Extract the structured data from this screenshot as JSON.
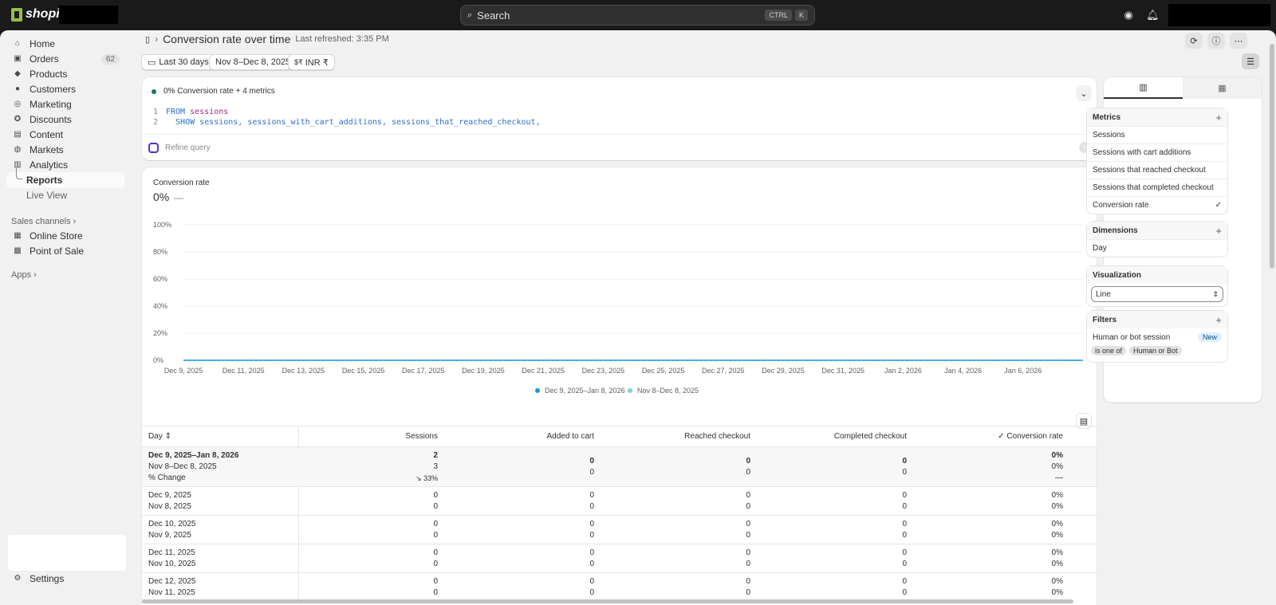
{
  "topbar": {
    "brand": "shopify",
    "search_placeholder": "Search",
    "kbd_ctrl": "CTRL",
    "kbd_k": "K"
  },
  "sidebar": {
    "items": [
      {
        "label": "Home",
        "icon": "home-icon"
      },
      {
        "label": "Orders",
        "icon": "orders-icon",
        "badge": "62"
      },
      {
        "label": "Products",
        "icon": "tag-icon"
      },
      {
        "label": "Customers",
        "icon": "person-icon"
      },
      {
        "label": "Marketing",
        "icon": "target-icon"
      },
      {
        "label": "Discounts",
        "icon": "discount-icon"
      },
      {
        "label": "Content",
        "icon": "content-icon"
      },
      {
        "label": "Markets",
        "icon": "globe-icon"
      },
      {
        "label": "Analytics",
        "icon": "bar-chart-icon"
      },
      {
        "label": "Reports"
      },
      {
        "label": "Live View"
      }
    ],
    "sales_channels_label": "Sales channels",
    "channels": [
      {
        "label": "Online Store"
      },
      {
        "label": "Point of Sale"
      }
    ],
    "apps_label": "Apps",
    "settings_label": "Settings"
  },
  "header": {
    "title": "Conversion rate over time",
    "refreshed": "Last refreshed: 3:35 PM"
  },
  "filters": {
    "range": "Last 30 days",
    "compare": "Nov 8–Dec 8, 2025",
    "currency": "INR ₹"
  },
  "query": {
    "summary": "0% Conversion rate + 4 metrics",
    "line1_num": "1",
    "line1_kw": "FROM",
    "line1_id": "sessions",
    "line2_num": "2",
    "line2_text": "  SHOW sessions, sessions_with_cart_additions, sessions_that_reached_checkout,",
    "refine": "Refine query"
  },
  "chart_data": {
    "type": "line",
    "title": "Conversion rate",
    "value": "0%",
    "value_change": "—",
    "ylabel": "",
    "xlabel": "",
    "ylim": [
      0,
      100
    ],
    "y_ticks": [
      "100%",
      "80%",
      "60%",
      "40%",
      "20%",
      "0%"
    ],
    "x_ticks": [
      "Dec 9, 2025",
      "Dec 11, 2025",
      "Dec 13, 2025",
      "Dec 15, 2025",
      "Dec 17, 2025",
      "Dec 19, 2025",
      "Dec 21, 2025",
      "Dec 23, 2025",
      "Dec 25, 2025",
      "Dec 27, 2025",
      "Dec 29, 2025",
      "Dec 31, 2025",
      "Jan 2, 2026",
      "Jan 4, 2026",
      "Jan 6, 2026"
    ],
    "series": [
      {
        "name": "Dec 9, 2025–Jan 8, 2026",
        "color": "#1f96e0",
        "values": [
          0,
          0,
          0,
          0,
          0,
          0,
          0,
          0,
          0,
          0,
          0,
          0,
          0,
          0,
          0,
          0,
          0,
          0,
          0,
          0,
          0,
          0,
          0,
          0,
          0,
          0,
          0,
          0,
          0,
          0,
          0
        ]
      },
      {
        "name": "Nov 8–Dec 8, 2025",
        "color": "#7dd3e0",
        "values": [
          0,
          0,
          0,
          0,
          0,
          0,
          0,
          0,
          0,
          0,
          0,
          0,
          0,
          0,
          0,
          0,
          0,
          0,
          0,
          0,
          0,
          0,
          0,
          0,
          0,
          0,
          0,
          0,
          0,
          0,
          0
        ]
      }
    ],
    "grid": true,
    "legend": "bottom"
  },
  "table": {
    "headers": [
      "Day",
      "Sessions",
      "Added to cart",
      "Reached checkout",
      "Completed checkout",
      "Conversion rate"
    ],
    "summary": {
      "labels": [
        "Dec 9, 2025–Jan 8, 2026",
        "Nov 8–Dec 8, 2025",
        "% Change"
      ],
      "sessions": [
        "2",
        "3",
        "↘ 33%"
      ],
      "added": [
        "0",
        "0"
      ],
      "reached": [
        "0",
        "0"
      ],
      "completed": [
        "0",
        "0"
      ],
      "conv": [
        "0%",
        "0%",
        "—"
      ]
    },
    "rows": [
      {
        "d1": "Dec 9, 2025",
        "d2": "Nov 8, 2025",
        "v": [
          "0",
          "0",
          "0",
          "0",
          "0",
          "0",
          "0",
          "0"
        ],
        "c1": "0%",
        "c2": "0%"
      },
      {
        "d1": "Dec 10, 2025",
        "d2": "Nov 9, 2025",
        "v": [
          "0",
          "0",
          "0",
          "0",
          "0",
          "0",
          "0",
          "0"
        ],
        "c1": "0%",
        "c2": "0%"
      },
      {
        "d1": "Dec 11, 2025",
        "d2": "Nov 10, 2025",
        "v": [
          "0",
          "0",
          "0",
          "0",
          "0",
          "0",
          "0",
          "0"
        ],
        "c1": "0%",
        "c2": "0%"
      },
      {
        "d1": "Dec 12, 2025",
        "d2": "Nov 11, 2025",
        "v": [
          "0",
          "0",
          "0",
          "0",
          "0",
          "0",
          "0",
          "0"
        ],
        "c1": "0%",
        "c2": "0%"
      }
    ]
  },
  "right_panel": {
    "metrics_label": "Metrics",
    "metrics": [
      "Sessions",
      "Sessions with cart additions",
      "Sessions that reached checkout",
      "Sessions that completed checkout",
      "Conversion rate"
    ],
    "dimensions_label": "Dimensions",
    "dimensions": [
      "Day"
    ],
    "visualization_label": "Visualization",
    "visualization_value": "Line",
    "filters_label": "Filters",
    "filter_name": "Human or bot session",
    "filter_badge": "New",
    "filter_op": "is one of",
    "filter_value": "Human or Bot"
  }
}
